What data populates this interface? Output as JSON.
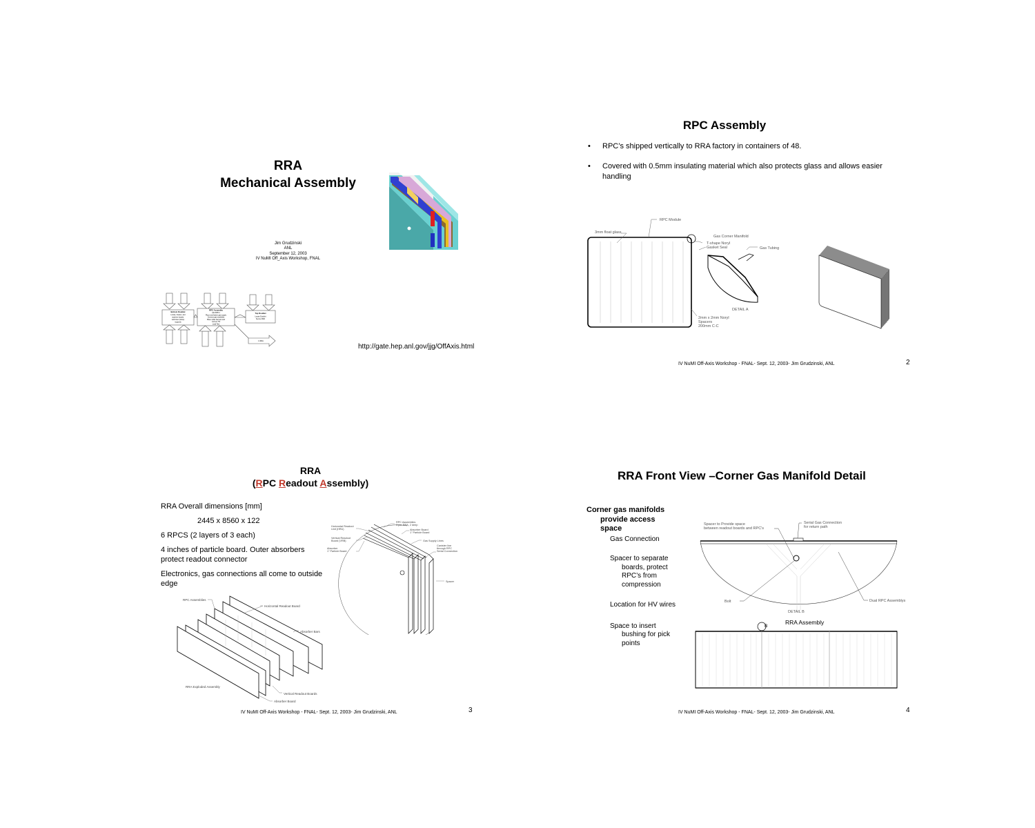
{
  "slide1": {
    "title_line1": "RRA",
    "title_line2": "Mechanical Assembly",
    "author": "Jim Grudzinski",
    "affiliation": "ANL",
    "date": "September 12, 2003",
    "event": "IV NuMI Off_Axis Workshop, FNAL",
    "url": "http://gate.hep.anl.gov/jjg/OffAxis.html",
    "flowchart": {
      "box_left_title": "Bottom Doublet",
      "box_left_text": [
        "Locate, Fasten, and",
        "machine boards.",
        "Add lower pickup",
        "supports"
      ],
      "box_mid_title": "RPC Assembly",
      "box_mid_text": [
        "Add RPC's",
        "Place and fasten gas supply",
        "Connect gas manifolds",
        "Place cable harness and",
        "connect HV",
        "Leak Test"
      ],
      "box_right_title": "Top Doublet",
      "box_right_text": [
        "Locate Doublet",
        "Secure RRA"
      ],
      "arrow_label": "1 RRA"
    }
  },
  "slide2": {
    "title": "RPC Assembly",
    "bullets": [
      "RPC’s shipped vertically to RRA factory in containers of 48.",
      "Covered with 0.5mm insulating material which also protects glass and allows easier handling"
    ],
    "labels": {
      "rpc_module": "RPC Module",
      "float_glass": "3mm float glass",
      "gas_corner_manifold": "Gas Corner Manifold",
      "gasket_1": "T-shape Noryl",
      "gasket_2": "Gasket Seal",
      "gas_tubing": "Gas Tubing",
      "detail": "DETAIL A",
      "spacers_1": "2mm x 2mm Noryl",
      "spacers_2": "Spacers",
      "spacers_3": "200mm C-C"
    },
    "footer": "IV NuMI Off-Axis Workshop - FNAL- Sept. 12, 2003- Jim Grudzinski, ANL",
    "page": "2"
  },
  "slide3": {
    "title_line1": "RRA",
    "title_open": "(",
    "title_r1": "R",
    "title_pc": "PC ",
    "title_r2": "R",
    "title_eadout": "eadout ",
    "title_a": "A",
    "title_ssembly": "ssembly)",
    "lines": {
      "dims_label": "RRA Overall dimensions [mm]",
      "dims_value": "2445 x 8560 x 122",
      "rpcs": "6 RPCS (2 layers of 3 each)",
      "particle": "4 inches of particle board. Outer absorbers protect readout connector",
      "electronics": "Electronics, gas connections all come to outside edge"
    },
    "labels": {
      "rpc_assemblies": "RPC Assemblies",
      "horizontal_readout": "Horizontal Readout Board",
      "absorber_bars": "Absorber Bars",
      "exploded": "RRA Exploded Assembly",
      "vertical_readout": "Vertical Readout Boards",
      "absorber_board": "Absorber Board",
      "d_rpc_assemblies_1": "RPC Assemblies",
      "d_rpc_assemblies_2": "3 per RRA, 2 deep",
      "d_absorber_board_1": "Absorber Board",
      "d_absorber_board_2": "1\" Particle Board",
      "d_horizontal_1": "Horizontal Readout",
      "d_horizontal_2": "Unit (HRU)",
      "d_gas_supply": "Gas Supply Lines",
      "d_vertical_1": "Vertical Readout",
      "d_vertical_2": "Board (VRB)",
      "d_absorber_1": "Absorber",
      "d_absorber_2": "1\" Particle Board",
      "d_canister_1": "Canister line",
      "d_canister_2": "through RPC",
      "d_canister_3": "Serial Connection",
      "d_spacer": "Spacer"
    },
    "footer": "IV NuMI Off-Axis Workshop - FNAL- Sept. 12, 2003- Jim Grudzinski, ANL",
    "page": "3"
  },
  "slide4": {
    "title": "RRA Front View –Corner Gas Manifold Detail",
    "heading_line1": "Corner gas manifolds",
    "heading_line2": "provide  access",
    "heading_line3": "space",
    "items": [
      "Gas Connection",
      "Spacer to separate boards, protect RPC’s from compression",
      "Location for HV wires",
      "Space to insert bushing for pick points"
    ],
    "labels": {
      "spacer_1": "Spacer to Provide space",
      "spacer_2": "between readout boards and RPC's",
      "serial_1": "Serial Gas Connection",
      "serial_2": "for return path",
      "bolt": "Bolt",
      "dual_rpc": "Dual RPC Assemblys",
      "detail": "DETAIL B",
      "rra_assembly": "RRA Assembly",
      "marker": "B"
    },
    "footer": "IV NuMI Off-Axis Workshop - FNAL- Sept. 12, 2003- Jim Grudzinski, ANL",
    "page": "4"
  }
}
